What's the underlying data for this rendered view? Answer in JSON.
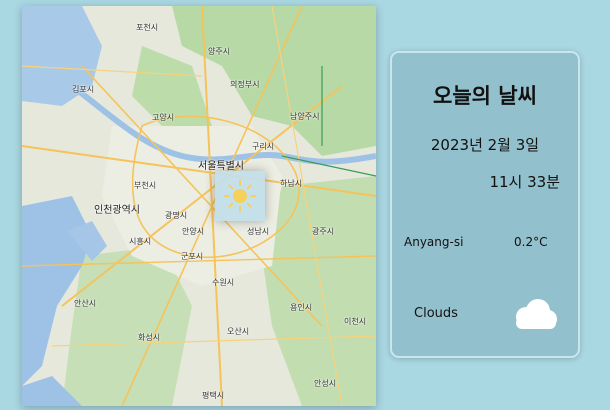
{
  "map": {
    "labels": {
      "pocheon": "포천시",
      "yangju": "양주시",
      "uijeongbu": "의정부시",
      "gimpo_airport": "김포시",
      "goyang": "고양시",
      "namyangju": "남양주시",
      "guri": "구리시",
      "seoul": "서울특별시",
      "bucheon": "부천시",
      "incheon": "인천광역시",
      "hanam": "하남시",
      "gwangmyeong": "광명시",
      "siheung": "시흥시",
      "anyang": "안양시",
      "seongnam": "성남시",
      "gwangju": "광주시",
      "gunpo": "군포시",
      "suwon": "수원시",
      "ansan": "안산시",
      "yongin": "용인시",
      "hwaseong": "화성시",
      "osan": "오산시",
      "icheon": "이천시",
      "pyeongtaek": "평택시",
      "anseong": "안성시"
    },
    "weather_icon": "sun-icon"
  },
  "card": {
    "title": "오늘의 날씨",
    "date": "2023년 2월 3일",
    "time": "11시 33분",
    "city": "Anyang-si",
    "temperature": "0.2°C",
    "condition": "Clouds",
    "condition_icon": "cloud-icon"
  }
}
